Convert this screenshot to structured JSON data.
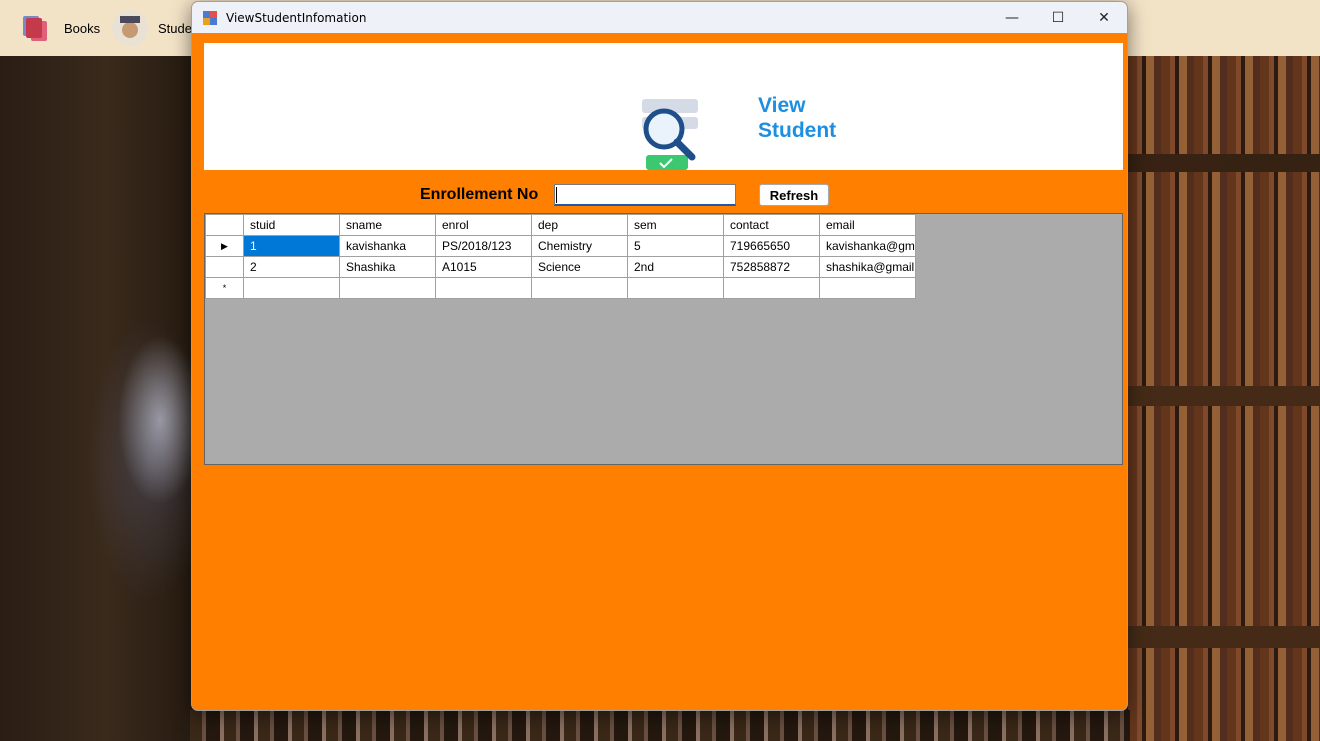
{
  "taskbar": {
    "items": [
      {
        "label": "Books",
        "icon": "books-icon"
      },
      {
        "label": "Studer",
        "icon": "student-icon"
      }
    ]
  },
  "window": {
    "title": "ViewStudentInfomation",
    "controls": {
      "minimize": "—",
      "maximize": "☐",
      "close": "✕"
    }
  },
  "header": {
    "title": "View\nStudent",
    "logo_icon": "magnifier-icon",
    "accent_color": "#1e8fe0"
  },
  "search": {
    "label": "Enrollement No",
    "value": "",
    "button_label": "Refresh"
  },
  "grid": {
    "columns": [
      "stuid",
      "sname",
      "enrol",
      "dep",
      "sem",
      "contact",
      "email"
    ],
    "rows": [
      {
        "marker": "▶",
        "cells": [
          "1",
          "kavishanka",
          "PS/2018/123",
          "Chemistry",
          "5",
          "719665650",
          "kavishanka@gm..."
        ]
      },
      {
        "marker": "",
        "cells": [
          "2",
          "Shashika",
          "A1015",
          "Science",
          "2nd",
          "752858872",
          "shashika@gmail...."
        ]
      },
      {
        "marker": "*",
        "cells": [
          "",
          "",
          "",
          "",
          "",
          "",
          ""
        ]
      }
    ]
  },
  "colors": {
    "window_bg": "#ff8000",
    "grid_bg": "#ababab",
    "selection": "#0078d7"
  }
}
